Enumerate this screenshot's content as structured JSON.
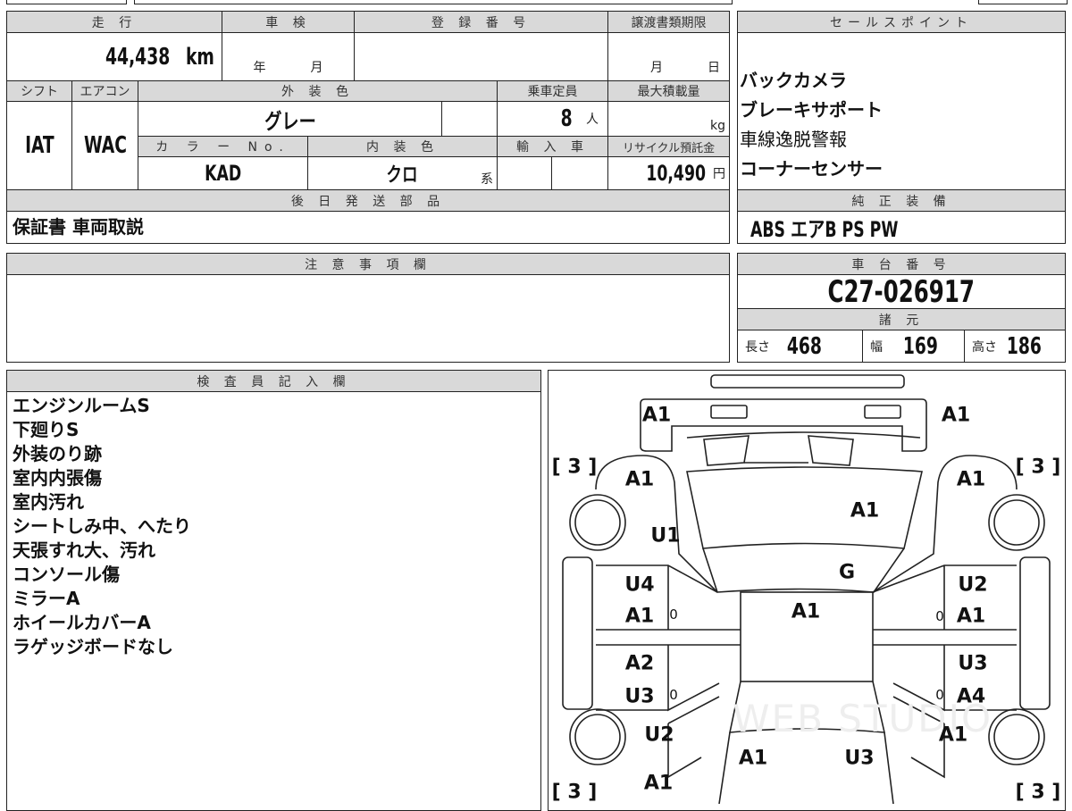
{
  "mileage": {
    "label": "走 行",
    "value": "44,438",
    "unit": "km"
  },
  "inspection": {
    "label": "車 検",
    "year": "年",
    "month": "月"
  },
  "registration": {
    "label": "登 録 番 号",
    "value": ""
  },
  "transfer_deadline": {
    "label": "譲渡書類期限",
    "month": "月",
    "day": "日"
  },
  "shift": {
    "label": "シフト",
    "value": "IAT"
  },
  "aircon": {
    "label": "エアコン",
    "value": "WAC"
  },
  "exterior_color": {
    "label": "外 装 色",
    "value": "グレー"
  },
  "capacity": {
    "label": "乗車定員",
    "value": "8",
    "unit": "人"
  },
  "max_load": {
    "label": "最大積載量",
    "unit": "kg"
  },
  "color_no": {
    "label": "カ ラ ー No.",
    "value": "KAD"
  },
  "interior_color": {
    "label": "内 装 色",
    "value": "クロ",
    "suffix": "系"
  },
  "import": {
    "label": "輸 入 車"
  },
  "recycle": {
    "label": "リサイクル預託金",
    "value": "10,490",
    "unit": "円"
  },
  "later_parts": {
    "label": "後 日 発 送 部 品",
    "value": "保証書 車両取説"
  },
  "notes": {
    "label": "注 意 事 項 欄"
  },
  "sales_points": {
    "label": "セールスポイント",
    "items": [
      "バックカメラ",
      "ブレーキサポート",
      "車線逸脱警報",
      "コーナーセンサー"
    ]
  },
  "equipment": {
    "label": "純 正 装 備",
    "value": "ABS エアB PS PW"
  },
  "chassis": {
    "label": "車 台 番 号",
    "value": "C27-026917"
  },
  "specs": {
    "label": "諸 元",
    "length_label": "長さ",
    "length": "468",
    "width_label": "幅",
    "width": "169",
    "height_label": "高さ",
    "height": "186"
  },
  "inspector": {
    "label": "検 査 員 記 入 欄",
    "items": [
      "エンジンルームS",
      "下廻りS",
      "外装のり跡",
      "室内内張傷",
      "室内汚れ",
      "シートしみ中、へたり",
      "天張すれ大、汚れ",
      "コンソール傷",
      "ミラーA",
      "ホイールカバーA",
      "ラゲッジボードなし"
    ]
  },
  "diagram": {
    "marks": [
      "A1",
      "A1",
      "[ 3 ]",
      "[ 3 ]",
      "A1",
      "A1",
      "A1",
      "U1",
      "G",
      "U4",
      "U2",
      "A1",
      "0",
      "A1",
      "0",
      "A1",
      "A2",
      "U3",
      "U3",
      "0",
      "0",
      "A4",
      "U2",
      "A1",
      "A1",
      "U3",
      "A1",
      "[ 3 ]",
      "[ 3 ]"
    ],
    "watermark": "WEB STUDIO"
  }
}
